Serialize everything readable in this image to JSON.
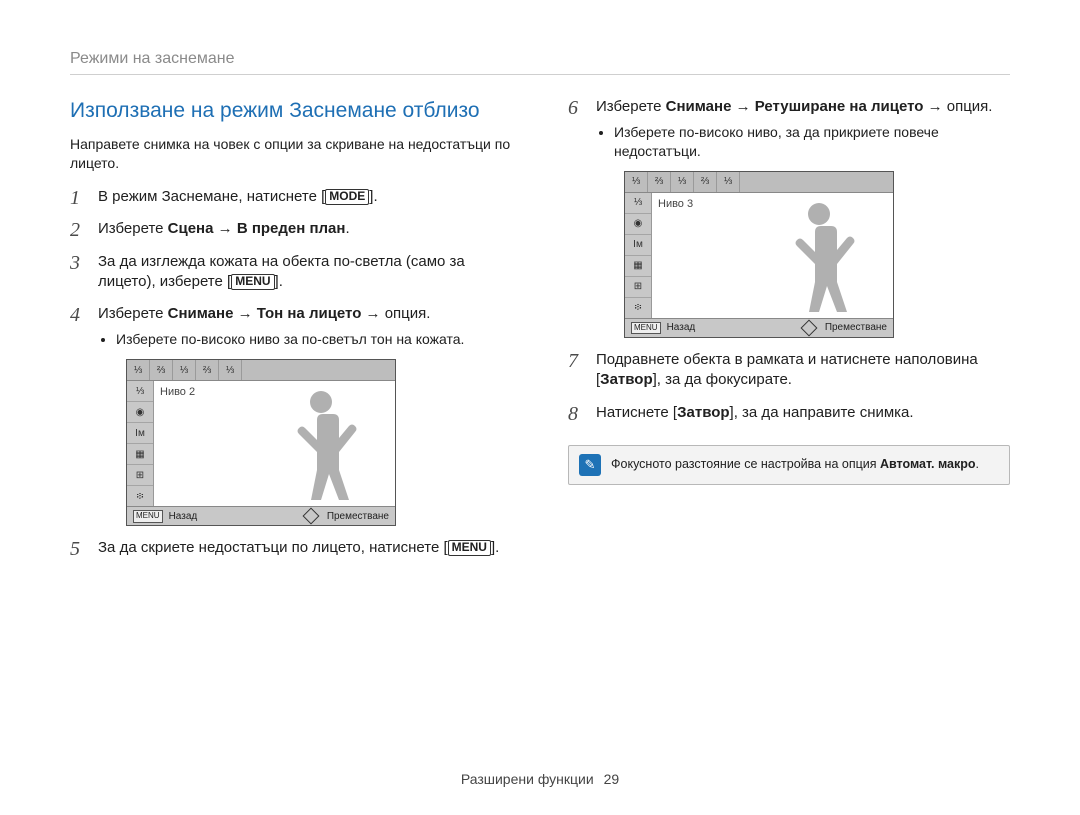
{
  "breadcrumb": "Режими на заснемане",
  "footer": {
    "section": "Разширени функции",
    "page": "29"
  },
  "section_title": "Използване на режим Заснемане отблизо",
  "intro": "Направете снимка на човек с опции за скриване на недостатъци по лицето.",
  "steps": {
    "s1": {
      "pre": "В режим Заснемане, натиснете [",
      "label": "MODE",
      "post": "]."
    },
    "s2": {
      "pre": "Изберете ",
      "b1": "Сцена",
      "arrow": " → ",
      "b2": "В преден план",
      "post": "."
    },
    "s3": {
      "pre": "За да изглежда кожата на обекта по-светла (само за лицето), изберете [",
      "label": "MENU",
      "post": "]."
    },
    "s4": {
      "pre": "Изберете ",
      "b1": "Снимане",
      "arrow1": " → ",
      "b2": "Тон на лицето",
      "arrow2": " → ",
      "tail": "опция.",
      "sub": "Изберете по-високо ниво за по-светъл тон на кожата."
    },
    "s5": {
      "pre": "За да скриете недостатъци по лицето, натиснете [",
      "label": "MENU",
      "post": "]."
    },
    "s6": {
      "pre": "Изберете ",
      "b1": "Снимане",
      "arrow1": " → ",
      "b2": "Ретуширане на лицето",
      "arrow2": " → ",
      "tail": "опция.",
      "sub": "Изберете по-високо ниво, за да прикриете повече недостатъци."
    },
    "s7": {
      "pre": "Подравнете обекта в рамката и натиснете наполовина [",
      "b": "Затвор",
      "post": "], за да фокусирате."
    },
    "s8": {
      "pre": "Натиснете [",
      "b": "Затвор",
      "post": "], за да направите снимка."
    }
  },
  "lcd1": {
    "level": "Ниво 2",
    "back": "Назад",
    "move": "Преместване",
    "menu": "MENU"
  },
  "lcd2": {
    "level": "Ниво 3",
    "back": "Назад",
    "move": "Преместване",
    "menu": "MENU"
  },
  "note": {
    "text_pre": "Фокусното разстояние се настройва на опция ",
    "bold": "Автомат. макро",
    "text_post": "."
  },
  "icons": {
    "top": [
      "⅓",
      "⅔",
      "⅓",
      "⅔",
      "⅓"
    ],
    "side": [
      "⅓",
      "◉",
      "Iм",
      "▦",
      "⊞",
      "፨"
    ]
  }
}
